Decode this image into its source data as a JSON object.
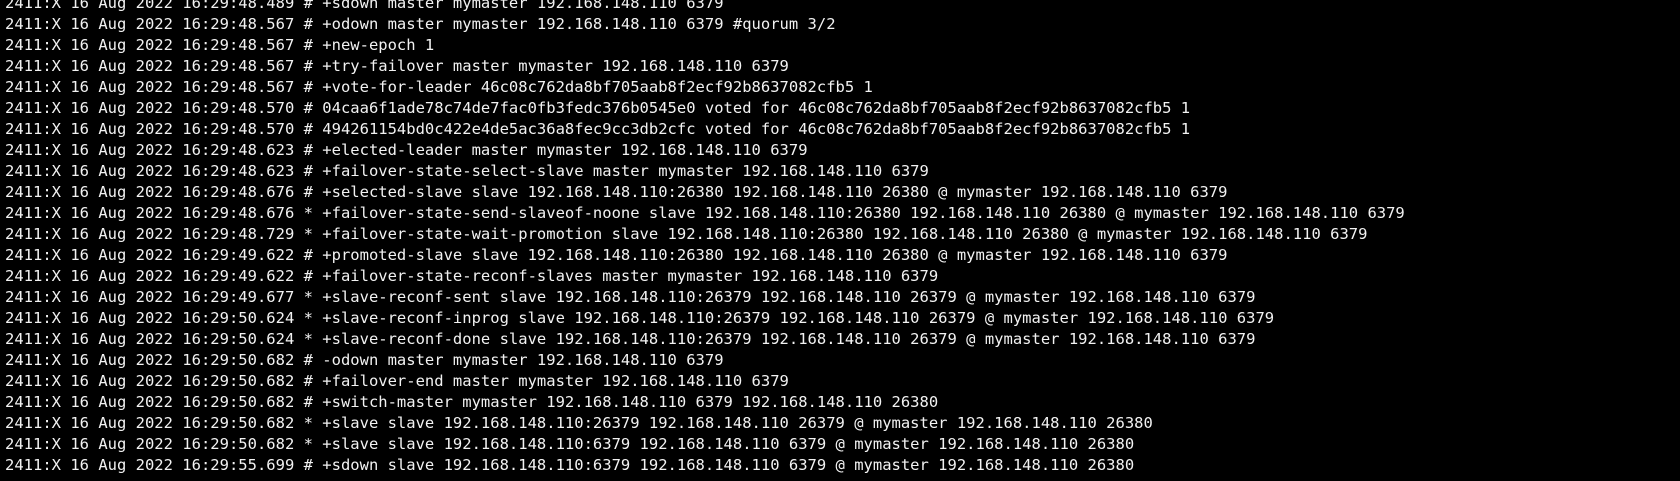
{
  "terminal": {
    "lines": [
      "2411:X 16 Aug 2022 16:29:48.489 # +sdown master mymaster 192.168.148.110 6379",
      "2411:X 16 Aug 2022 16:29:48.567 # +odown master mymaster 192.168.148.110 6379 #quorum 3/2",
      "2411:X 16 Aug 2022 16:29:48.567 # +new-epoch 1",
      "2411:X 16 Aug 2022 16:29:48.567 # +try-failover master mymaster 192.168.148.110 6379",
      "2411:X 16 Aug 2022 16:29:48.567 # +vote-for-leader 46c08c762da8bf705aab8f2ecf92b8637082cfb5 1",
      "2411:X 16 Aug 2022 16:29:48.570 # 04caa6f1ade78c74de7fac0fb3fedc376b0545e0 voted for 46c08c762da8bf705aab8f2ecf92b8637082cfb5 1",
      "2411:X 16 Aug 2022 16:29:48.570 # 494261154bd0c422e4de5ac36a8fec9cc3db2cfc voted for 46c08c762da8bf705aab8f2ecf92b8637082cfb5 1",
      "2411:X 16 Aug 2022 16:29:48.623 # +elected-leader master mymaster 192.168.148.110 6379",
      "2411:X 16 Aug 2022 16:29:48.623 # +failover-state-select-slave master mymaster 192.168.148.110 6379",
      "2411:X 16 Aug 2022 16:29:48.676 # +selected-slave slave 192.168.148.110:26380 192.168.148.110 26380 @ mymaster 192.168.148.110 6379",
      "2411:X 16 Aug 2022 16:29:48.676 * +failover-state-send-slaveof-noone slave 192.168.148.110:26380 192.168.148.110 26380 @ mymaster 192.168.148.110 6379",
      "2411:X 16 Aug 2022 16:29:48.729 * +failover-state-wait-promotion slave 192.168.148.110:26380 192.168.148.110 26380 @ mymaster 192.168.148.110 6379",
      "2411:X 16 Aug 2022 16:29:49.622 # +promoted-slave slave 192.168.148.110:26380 192.168.148.110 26380 @ mymaster 192.168.148.110 6379",
      "2411:X 16 Aug 2022 16:29:49.622 # +failover-state-reconf-slaves master mymaster 192.168.148.110 6379",
      "2411:X 16 Aug 2022 16:29:49.677 * +slave-reconf-sent slave 192.168.148.110:26379 192.168.148.110 26379 @ mymaster 192.168.148.110 6379",
      "2411:X 16 Aug 2022 16:29:50.624 * +slave-reconf-inprog slave 192.168.148.110:26379 192.168.148.110 26379 @ mymaster 192.168.148.110 6379",
      "2411:X 16 Aug 2022 16:29:50.624 * +slave-reconf-done slave 192.168.148.110:26379 192.168.148.110 26379 @ mymaster 192.168.148.110 6379",
      "2411:X 16 Aug 2022 16:29:50.682 # -odown master mymaster 192.168.148.110 6379",
      "2411:X 16 Aug 2022 16:29:50.682 # +failover-end master mymaster 192.168.148.110 6379",
      "2411:X 16 Aug 2022 16:29:50.682 # +switch-master mymaster 192.168.148.110 6379 192.168.148.110 26380",
      "2411:X 16 Aug 2022 16:29:50.682 * +slave slave 192.168.148.110:26379 192.168.148.110 26379 @ mymaster 192.168.148.110 26380",
      "2411:X 16 Aug 2022 16:29:50.682 * +slave slave 192.168.148.110:6379 192.168.148.110 6379 @ mymaster 192.168.148.110 26380",
      "2411:X 16 Aug 2022 16:29:55.699 # +sdown slave 192.168.148.110:6379 192.168.148.110 6379 @ mymaster 192.168.148.110 26380"
    ]
  },
  "colors": {
    "background": "#000000",
    "text": "#f2f2f2"
  }
}
